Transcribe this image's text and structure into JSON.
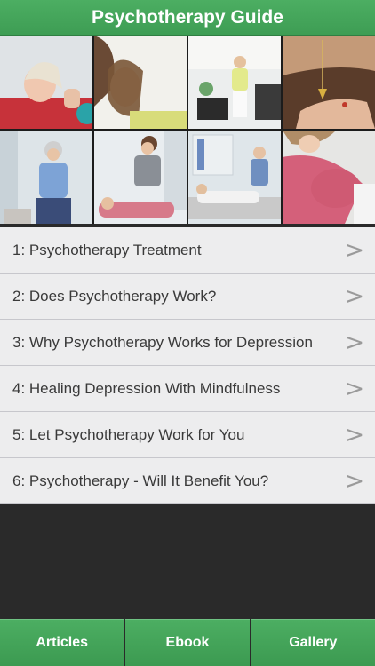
{
  "header": {
    "title": "Psychotherapy Guide"
  },
  "gallery": {
    "images": [
      "woman-relaxing-photo",
      "woman-on-couch-photo",
      "therapy-session-photo",
      "pendulum-hypnosis-photo",
      "counselor-gesturing-photo",
      "therapist-with-client-photo",
      "patient-lying-photo",
      "pregnant-woman-photo"
    ]
  },
  "list": {
    "items": [
      {
        "label": "1: Psychotherapy Treatment"
      },
      {
        "label": "2: Does Psychotherapy Work?"
      },
      {
        "label": "3: Why Psychotherapy Works for Depression"
      },
      {
        "label": "4: Healing Depression With Mindfulness"
      },
      {
        "label": "5: Let Psychotherapy Work for You"
      },
      {
        "label": "6: Psychotherapy - Will It Benefit You?"
      }
    ],
    "chevron": ">"
  },
  "tabs": [
    {
      "label": "Articles"
    },
    {
      "label": "Ebook"
    },
    {
      "label": "Gallery"
    }
  ],
  "colors": {
    "accent": "#45a55b",
    "list_bg": "#ededee",
    "dark_bg": "#2a2a2a"
  }
}
